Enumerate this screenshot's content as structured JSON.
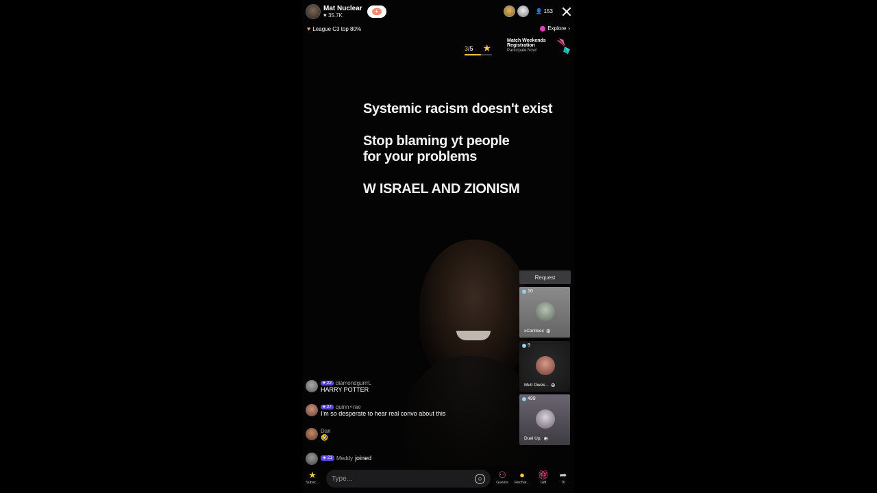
{
  "host": {
    "name": "Mat Nuclear",
    "likes": "35.7K"
  },
  "viewers": {
    "count": "153"
  },
  "league": {
    "label": "League C3 top 80%"
  },
  "explore": {
    "label": "Explore"
  },
  "goal": {
    "current": "3",
    "total": "/5",
    "progress": 0.6
  },
  "event": {
    "title": "Match Weekends Registration",
    "subtitle": "Participate Now!"
  },
  "overlay": {
    "line1": "Systemic racism doesn't exist",
    "line2": "Stop blaming yt people\nfor your problems",
    "line3": "W ISRAEL AND ZIONISM"
  },
  "guests": {
    "request_label": "Request",
    "items": [
      {
        "score": "10",
        "name": "xCarlitoex"
      },
      {
        "score": "9",
        "name": "Muti Dwek..."
      },
      {
        "score": "499",
        "name": "Duel Up."
      }
    ]
  },
  "chat": [
    {
      "level": "22",
      "user": "diamondgurrrL",
      "text": "HARRY POTTER"
    },
    {
      "level": "27",
      "user": "quinn⚡rae",
      "text": "I'm so desperate to hear real convo about this"
    },
    {
      "level": "",
      "user": "Dan",
      "text": "🤣"
    }
  ],
  "join": {
    "level": "21",
    "user": "Meddy",
    "text": "joined"
  },
  "bottom": {
    "subscribe_label": "Subsc...",
    "input_placeholder": "Type...",
    "guests_label": "Guests",
    "recharge_label": "Rechar...",
    "gift_label": "Gift",
    "share_label": "70"
  }
}
